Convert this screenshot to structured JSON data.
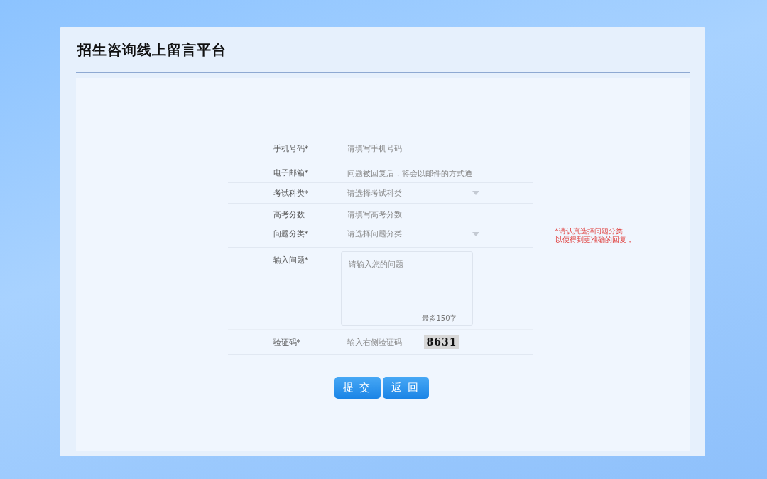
{
  "window": {
    "title": "招生咨询线上留言平台"
  },
  "form": {
    "fields": [
      {
        "kind": "text",
        "label": "手机号码*",
        "placeholder": "请填写手机号码"
      },
      {
        "kind": "text",
        "label": "电子邮箱*",
        "placeholder": "问题被回复后，将会以邮件的方式通"
      },
      {
        "kind": "select",
        "label": "考试科类*",
        "placeholder": "请选择考试科类"
      },
      {
        "kind": "text",
        "label": "高考分数",
        "placeholder": "请填写高考分数"
      },
      {
        "kind": "select",
        "label": "问题分类*",
        "placeholder": "请选择问题分类",
        "note": [
          "*请认真选择问题分类",
          "以便得到更准确的回复，"
        ]
      },
      {
        "kind": "textarea",
        "label": "输入问题*",
        "placeholder": "请输入您的问题",
        "hint": "最多150字"
      },
      {
        "kind": "captcha",
        "label": "验证码*",
        "placeholder": "输入右侧验证码",
        "code": "8631"
      }
    ],
    "buttons": [
      "提 交",
      "返 回"
    ]
  }
}
